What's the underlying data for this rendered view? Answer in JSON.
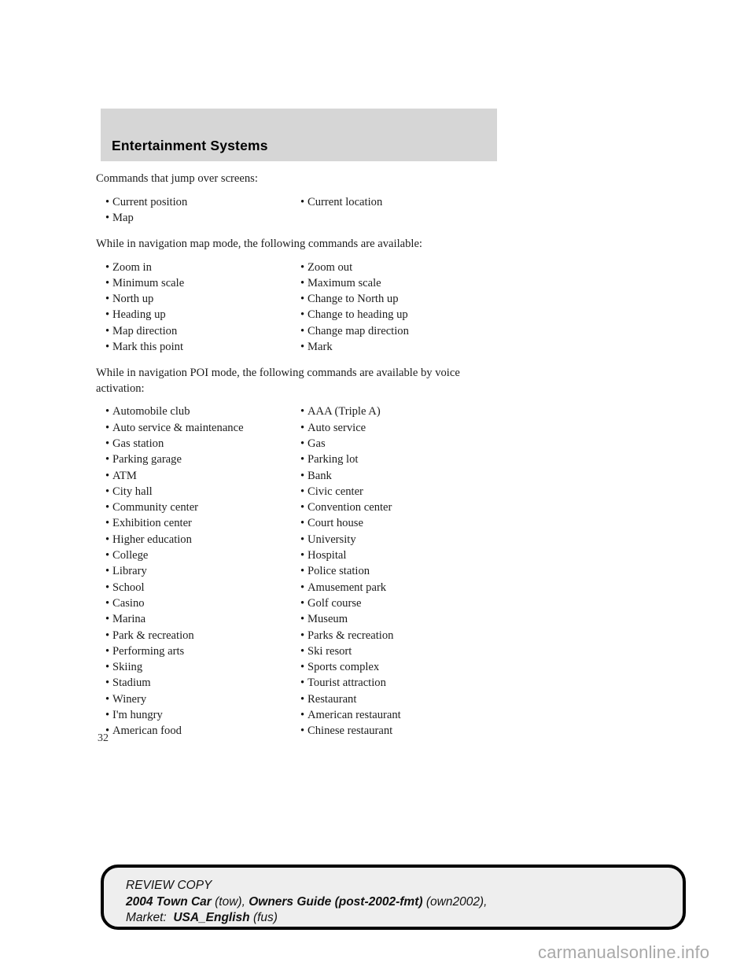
{
  "header": {
    "title": "Entertainment Systems"
  },
  "body": {
    "intro_jump": "Commands that jump over screens:",
    "intro_map": "While in navigation map mode, the following commands are available:",
    "intro_poi": "While in navigation POI mode, the following commands are available by voice activation:",
    "jump_commands": [
      {
        "left": "Current position",
        "right": "Current location"
      },
      {
        "left": "Map",
        "right": ""
      }
    ],
    "map_commands": [
      {
        "left": "Zoom in",
        "right": "Zoom out"
      },
      {
        "left": "Minimum scale",
        "right": "Maximum scale"
      },
      {
        "left": "North up",
        "right": "Change to North up"
      },
      {
        "left": "Heading up",
        "right": "Change to heading up"
      },
      {
        "left": "Map direction",
        "right": "Change map direction"
      },
      {
        "left": "Mark this point",
        "right": "Mark"
      }
    ],
    "poi_commands": [
      {
        "left": "Automobile club",
        "right": "AAA (Triple A)"
      },
      {
        "left": "Auto service & maintenance",
        "right": "Auto service"
      },
      {
        "left": "Gas station",
        "right": "Gas"
      },
      {
        "left": "Parking garage",
        "right": "Parking lot"
      },
      {
        "left": "ATM",
        "right": "Bank"
      },
      {
        "left": "City hall",
        "right": "Civic center"
      },
      {
        "left": "Community center",
        "right": "Convention center"
      },
      {
        "left": "Exhibition center",
        "right": "Court house"
      },
      {
        "left": "Higher education",
        "right": "University"
      },
      {
        "left": "College",
        "right": "Hospital"
      },
      {
        "left": "Library",
        "right": "Police station"
      },
      {
        "left": "School",
        "right": "Amusement park"
      },
      {
        "left": "Casino",
        "right": "Golf course"
      },
      {
        "left": "Marina",
        "right": "Museum"
      },
      {
        "left": "Park & recreation",
        "right": "Parks & recreation"
      },
      {
        "left": "Performing arts",
        "right": "Ski resort"
      },
      {
        "left": "Skiing",
        "right": "Sports complex"
      },
      {
        "left": "Stadium",
        "right": "Tourist attraction"
      },
      {
        "left": "Winery",
        "right": "Restaurant"
      },
      {
        "left": "I'm hungry",
        "right": "American restaurant"
      },
      {
        "left": "American food",
        "right": "Chinese restaurant"
      }
    ],
    "bullet_glyph": "•",
    "page_number": "32"
  },
  "footer": {
    "review_copy": "REVIEW COPY",
    "model": "2004 Town Car",
    "model_code": "(tow),",
    "guide": "Owners Guide (post-2002-fmt)",
    "guide_code": "(own2002),",
    "market_label": "Market:",
    "market_value": "USA_English",
    "market_code": "(fus)"
  },
  "watermark": {
    "text": "carmanualsonline.info"
  },
  "colors": {
    "header_band": "#d6d6d6",
    "footer_fill": "#eeeeee",
    "footer_border": "#000000",
    "watermark": "#a8a8a8",
    "body_text": "#1c1c1c"
  }
}
